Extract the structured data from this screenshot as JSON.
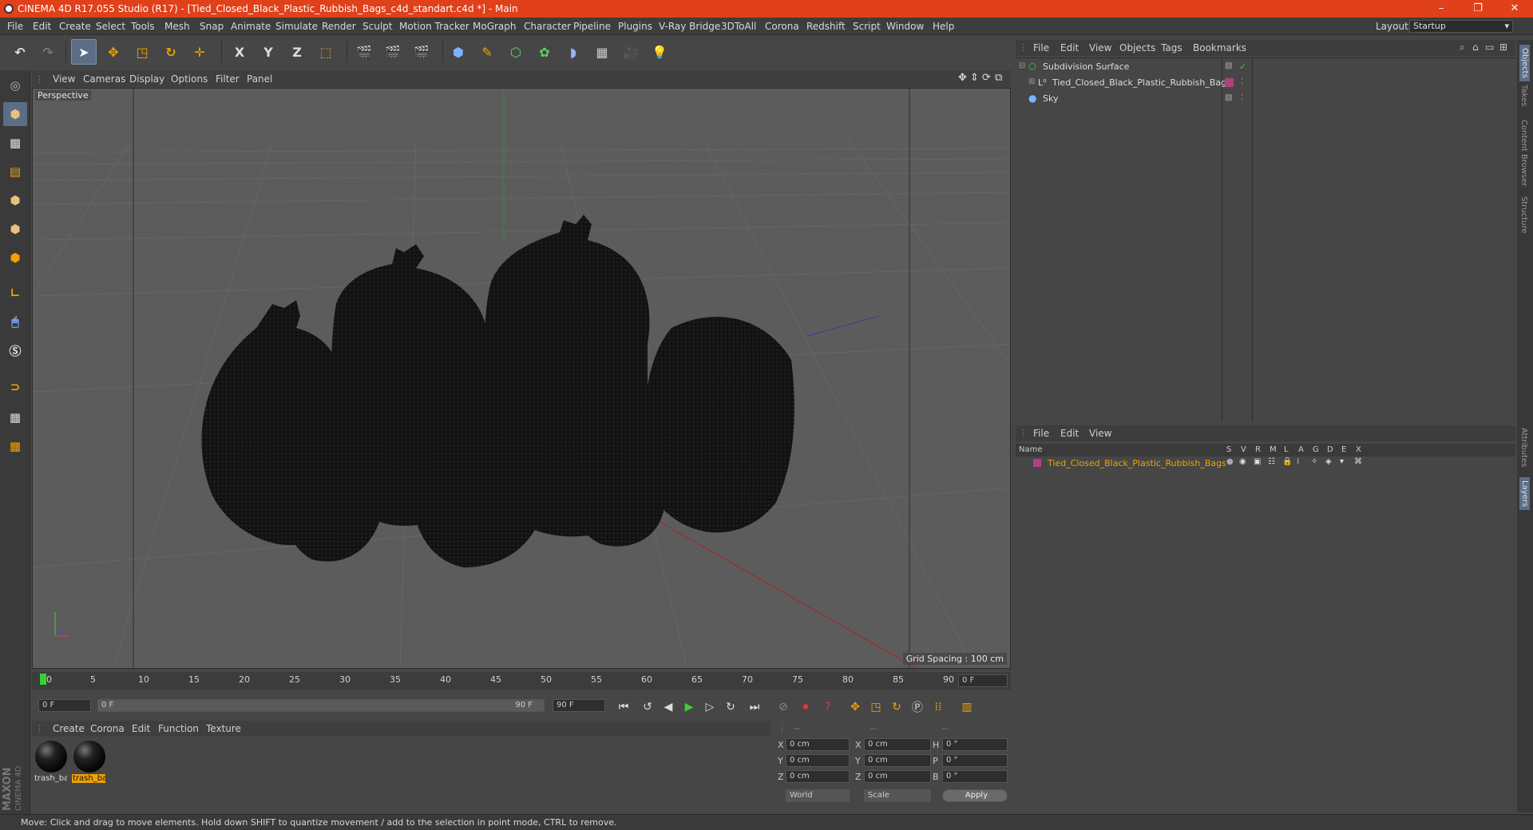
{
  "window": {
    "title": "CINEMA 4D R17.055 Studio (R17) - [Tied_Closed_Black_Plastic_Rubbish_Bags_c4d_standart.c4d *] - Main",
    "minimize": "–",
    "restore": "❐",
    "close": "✕"
  },
  "menubar": {
    "items": [
      "File",
      "Edit",
      "Create",
      "Select",
      "Tools",
      "Mesh",
      "Snap",
      "Animate",
      "Simulate",
      "Render",
      "Sculpt",
      "Motion Tracker",
      "MoGraph",
      "Character",
      "Pipeline",
      "Plugins",
      "V-Ray Bridge",
      "3DToAll",
      "Corona",
      "Redshift",
      "Script",
      "Window",
      "Help"
    ],
    "layout_label": "Layout:",
    "layout_value": "Startup"
  },
  "toolbar": {
    "x_label": "X",
    "y_label": "Y",
    "z_label": "Z"
  },
  "viewport": {
    "menu": [
      "View",
      "Cameras",
      "Display",
      "Options",
      "Filter",
      "Panel"
    ],
    "label": "Perspective",
    "grid_spacing": "Grid Spacing : 100 cm"
  },
  "timeline": {
    "ticks": [
      "0",
      "5",
      "10",
      "15",
      "20",
      "25",
      "30",
      "35",
      "40",
      "45",
      "50",
      "55",
      "60",
      "65",
      "70",
      "75",
      "80",
      "85",
      "90"
    ],
    "current_frame": "0 F"
  },
  "transport": {
    "start_field": "0 F",
    "range_start": "0 F",
    "range_end": "90 F",
    "end_field": "90 F"
  },
  "materials": {
    "menu": [
      "Create",
      "Corona",
      "Edit",
      "Function",
      "Texture"
    ],
    "items": [
      {
        "name": "trash_ba"
      },
      {
        "name": "trash_ba"
      }
    ]
  },
  "maxon": {
    "brand": "MAXON",
    "product": "CINEMA 4D"
  },
  "coordinates": {
    "headers": [
      "--",
      "--",
      "--"
    ],
    "rows": [
      {
        "a": "X",
        "av": "0 cm",
        "b": "X",
        "bv": "0 cm",
        "c": "H",
        "cv": "0 °"
      },
      {
        "a": "Y",
        "av": "0 cm",
        "b": "Y",
        "bv": "0 cm",
        "c": "P",
        "cv": "0 °"
      },
      {
        "a": "Z",
        "av": "0 cm",
        "b": "Z",
        "bv": "0 cm",
        "c": "B",
        "cv": "0 °"
      }
    ],
    "world": "World",
    "scale": "Scale",
    "apply": "Apply"
  },
  "objects": {
    "menu": [
      "File",
      "Edit",
      "View",
      "Objects",
      "Tags",
      "Bookmarks"
    ],
    "items": [
      {
        "name": "Subdivision Surface"
      },
      {
        "name": "Tied_Closed_Black_Plastic_Rubbish_Bags"
      },
      {
        "name": "Sky"
      }
    ]
  },
  "layers": {
    "menu": [
      "File",
      "Edit",
      "View"
    ],
    "name_header": "Name",
    "columns": [
      "S",
      "V",
      "R",
      "M",
      "L",
      "A",
      "G",
      "D",
      "E",
      "X"
    ],
    "items": [
      {
        "name": "Tied_Closed_Black_Plastic_Rubbish_Bags"
      }
    ]
  },
  "right_tabs": [
    "Objects",
    "Takes",
    "Content Browser",
    "Structure",
    "Attributes",
    "Layers"
  ],
  "status": {
    "text": "Move: Click and drag to move elements. Hold down SHIFT to quantize movement / add to the selection in point mode, CTRL to remove."
  },
  "colors": {
    "titlebar": "#e0401a",
    "selection": "#f0a200",
    "layer_color": "#b0417f"
  }
}
